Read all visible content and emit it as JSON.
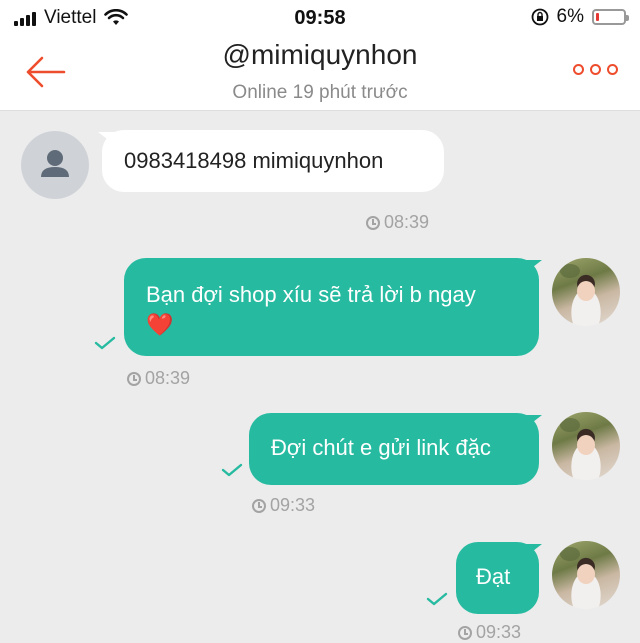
{
  "status_bar": {
    "carrier": "Viettel",
    "time": "09:58",
    "battery": "6%",
    "battery_level": 0.06,
    "icons": [
      "signal-icon",
      "wifi-icon",
      "orientation-lock-icon",
      "battery-icon"
    ]
  },
  "header": {
    "title": "@mimiquynhon",
    "subtitle": "Online 19 phút trước",
    "back_icon": "back-arrow-icon",
    "more_icon": "more-dots-icon"
  },
  "colors": {
    "accent": "#ee4d2d",
    "outgoing_bubble": "#26bba0",
    "incoming_bubble": "#ffffff",
    "background": "#ececec"
  },
  "messages": [
    {
      "direction": "incoming",
      "text": "0983418498 mimiquynhon",
      "time": "08:39"
    },
    {
      "direction": "outgoing",
      "text": "Bạn đợi shop xíu sẽ trả lời b ngay",
      "emoji": "❤️",
      "time": "08:39",
      "read": true
    },
    {
      "direction": "outgoing",
      "text": "Đợi chút e gửi link đặc",
      "time": "09:33",
      "read": true
    },
    {
      "direction": "outgoing",
      "text": "Đạt",
      "time": "09:33",
      "read": true
    }
  ]
}
